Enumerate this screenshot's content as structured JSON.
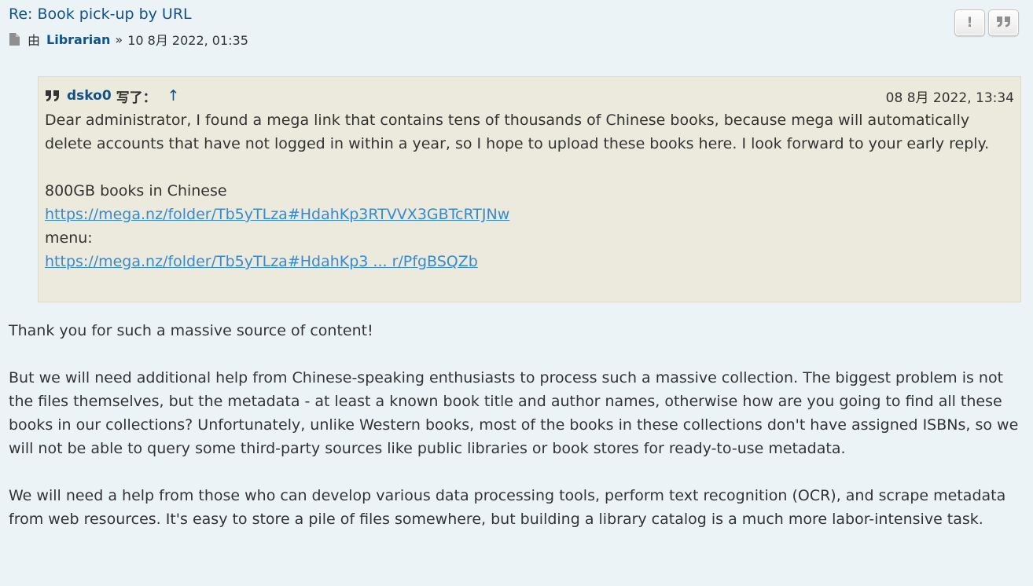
{
  "post": {
    "title": "Re: Book pick-up by URL",
    "by_label": "由",
    "author": "Librarian",
    "separator": "»",
    "datetime": "10 8月 2022, 01:35"
  },
  "actions": {
    "report_glyph": "!",
    "quote_glyph": "❝"
  },
  "quote": {
    "user": "dsko0",
    "wrote_label": "写了：",
    "jump_arrow": "↑",
    "datetime": "08 8月 2022, 13:34",
    "paragraph": "Dear administrator, I found a mega link that contains tens of thousands of Chinese books, because mega will automatically delete accounts that have not logged in within a year, so I hope to upload these books here. I look forward to your early reply.",
    "books_label": "800GB books in Chinese",
    "books_link": "https://mega.nz/folder/Tb5yTLza#HdahKp3RTVVX3GBTcRTJNw",
    "menu_label": "menu:",
    "menu_link": "https://mega.nz/folder/Tb5yTLza#HdahKp3 ... r/PfgBSQZb"
  },
  "content": {
    "p1": "Thank you for such a massive source of content!",
    "p2": "But we will need additional help from Chinese-speaking enthusiasts to process such a massive collection. The biggest problem is not the files themselves, but the metadata - at least a known book title and author names, otherwise how are you going to find all these books in our collections? Unfortunately, unlike Western books, most of the books in these collections don't have assigned ISBNs, so we will not be able to query some third-party sources like public libraries or book stores for ready-to-use metadata.",
    "p3": "We will need a help from those who can develop various data processing tools, perform text recognition (OCR), and scrape metadata from web resources. It's easy to store a pile of files somewhere, but building a library catalog is a much more labor-intensive task."
  },
  "colors": {
    "background": "#ECF3F7",
    "link": "#105289",
    "quote_link": "#368AD2",
    "quote_bg": "#EBEADD",
    "text": "#333333"
  },
  "icons": {
    "post_icon": "file-icon",
    "report": "exclamation-icon",
    "quote": "quote-icon",
    "cite": "quote-icon"
  }
}
